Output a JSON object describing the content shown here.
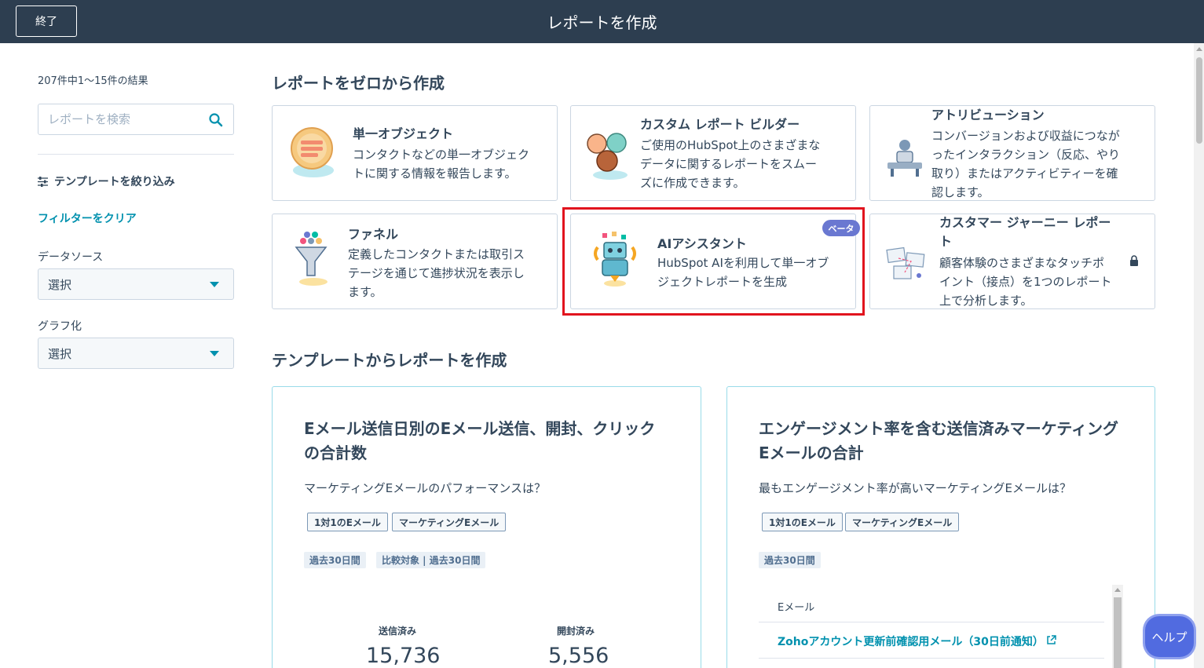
{
  "header": {
    "exit_label": "終了",
    "title": "レポートを作成"
  },
  "sidebar": {
    "result_count": "207件中1～15件の結果",
    "search_placeholder": "レポートを検索",
    "filter_title": "テンプレートを絞り込み",
    "clear_filters": "フィルターをクリア",
    "data_source_label": "データソース",
    "data_source_value": "選択",
    "visualization_label": "グラフ化",
    "visualization_value": "選択"
  },
  "scratch": {
    "title": "レポートをゼロから作成",
    "cards": [
      {
        "title": "単一オブジェクト",
        "lines": [
          "コンタクトなどの単一オブジェク",
          "トに関する情報を報告します。"
        ]
      },
      {
        "title": "カスタム レポート ビルダー",
        "lines": [
          "ご使用のHubSpot上のさまざまな",
          "データに関するレポートをスムー",
          "ズに作成できます。"
        ]
      },
      {
        "title": "アトリビューション",
        "lines": [
          "コンバージョンおよび収益につなが",
          "ったインタラクション（反応、やり",
          "取り）またはアクティビティーを確",
          "認します。"
        ]
      },
      {
        "title": "ファネル",
        "lines": [
          "定義したコンタクトまたは取引ス",
          "テージを通じて進捗状況を表示し",
          "ます。"
        ]
      },
      {
        "title": "AIアシスタント",
        "lines": [
          "HubSpot AIを利用して単一オブ",
          "ジェクトレポートを生成"
        ],
        "badge": "ベータ"
      },
      {
        "title_lines": [
          "カスタマー ジャーニー レポー",
          "ト"
        ],
        "lines": [
          "顧客体験のさまざまなタッチポ",
          "イント（接点）を1つのレポート",
          "上で分析します。"
        ]
      }
    ]
  },
  "templates": {
    "title": "テンプレートからレポートを作成",
    "cards": [
      {
        "title_lines": [
          "Eメール送信日別のEメール送信、開封、クリック",
          "の合計数"
        ],
        "question": "マーケティングEメールのパフォーマンスは？",
        "tags": [
          "1対1のEメール",
          "マーケティングEメール"
        ],
        "periods": [
          "過去30日間",
          "比較対象 | 過去30日間"
        ],
        "metrics": [
          {
            "label": "送信済み",
            "value": "15,736"
          },
          {
            "label": "開封済み",
            "value": "5,556"
          }
        ]
      },
      {
        "title_lines": [
          "エンゲージメント率を含む送信済みマーケティング",
          "Eメールの合計"
        ],
        "question": "最もエンゲージメント率が高いマーケティングEメールは？",
        "tags": [
          "1対1のEメール",
          "マーケティングEメール"
        ],
        "periods": [
          "過去30日間"
        ],
        "table_header": "Eメール",
        "table_row": "Zohoアカウント更新前確認用メール（30日前通知）"
      }
    ]
  },
  "help_label": "ヘルプ",
  "colors": {
    "header": "#2d3e50",
    "accent": "#0091ae",
    "highlight": "#e1141e",
    "beta": "#6a78d1",
    "help": "#516be0"
  }
}
